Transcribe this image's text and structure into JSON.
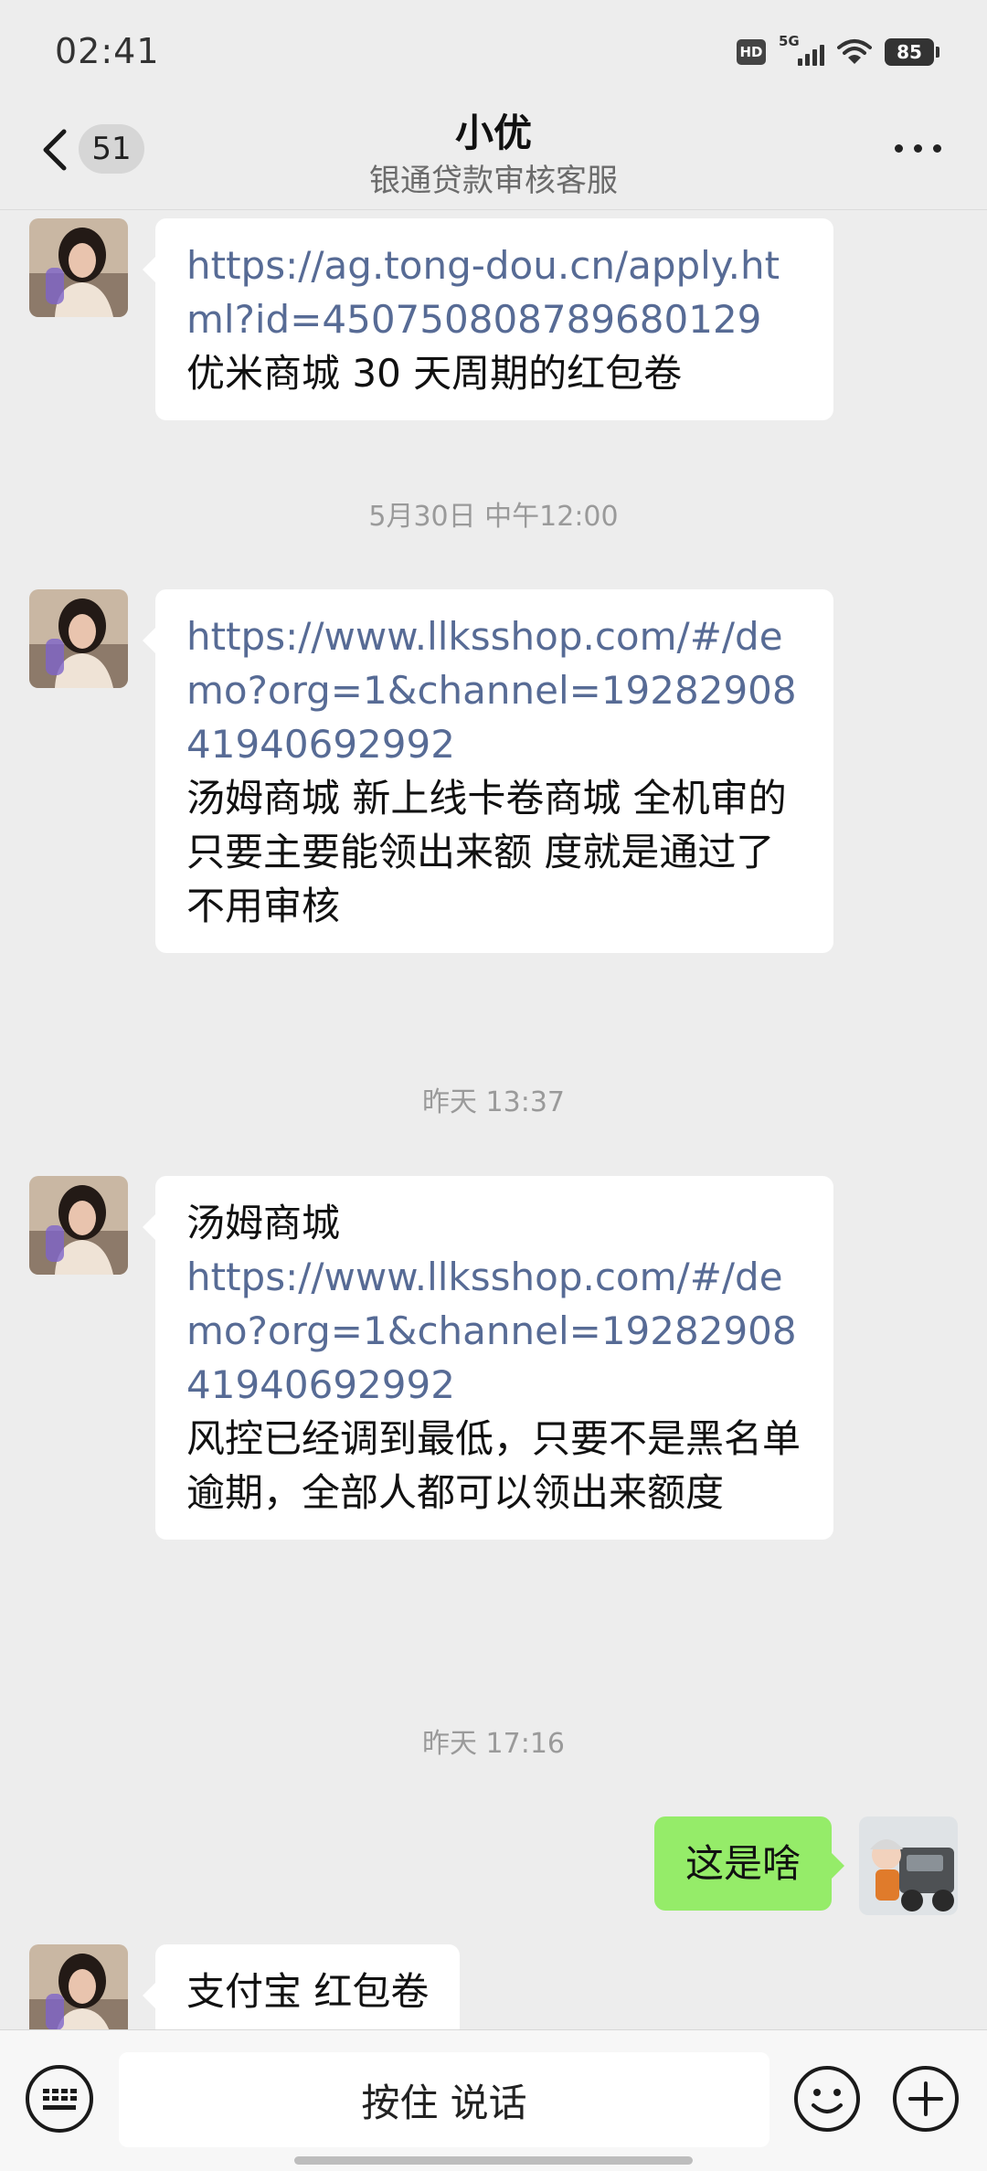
{
  "status_bar": {
    "time": "02:41",
    "hd": "HD",
    "network": "5G",
    "battery": "85"
  },
  "header": {
    "unread_count": "51",
    "title": "小优",
    "subtitle": "银通贷款审核客服"
  },
  "messages": [
    {
      "sender": "contact",
      "link": "https://ag.tong-dou.cn/apply.html?id=450750808789680129",
      "text": "优米商城 30 天周期的红包卷"
    },
    {
      "timestamp": "5月30日 中午12:00"
    },
    {
      "sender": "contact",
      "link": "https://www.llksshop.com/#/demo?org=1&channel=1928290841940692992",
      "text": "汤姆商城 新上线卡卷商城 全机审的 只要主要能领出来额 度就是通过了 不用审核"
    },
    {
      "timestamp": "昨天 13:37"
    },
    {
      "sender": "contact",
      "prefix": "汤姆商城",
      "link": "https://www.llksshop.com/#/demo?org=1&channel=1928290841940692992",
      "text": "风控已经调到最低，只要不是黑名单逾期，全部人都可以领出来额度"
    },
    {
      "timestamp": "昨天 17:16"
    },
    {
      "sender": "me",
      "text": "这是啥"
    },
    {
      "sender": "contact",
      "text": "支付宝 红包卷"
    }
  ],
  "input_bar": {
    "voice_label": "按住 说话",
    "left_icon": "keyboard-icon",
    "right_icons": [
      "emoji-icon",
      "plus-icon"
    ]
  },
  "colors": {
    "background": "#ededed",
    "bubble_in": "#ffffff",
    "bubble_out": "#95ec69",
    "link": "#576b95",
    "timestamp": "#9a9a9a"
  }
}
